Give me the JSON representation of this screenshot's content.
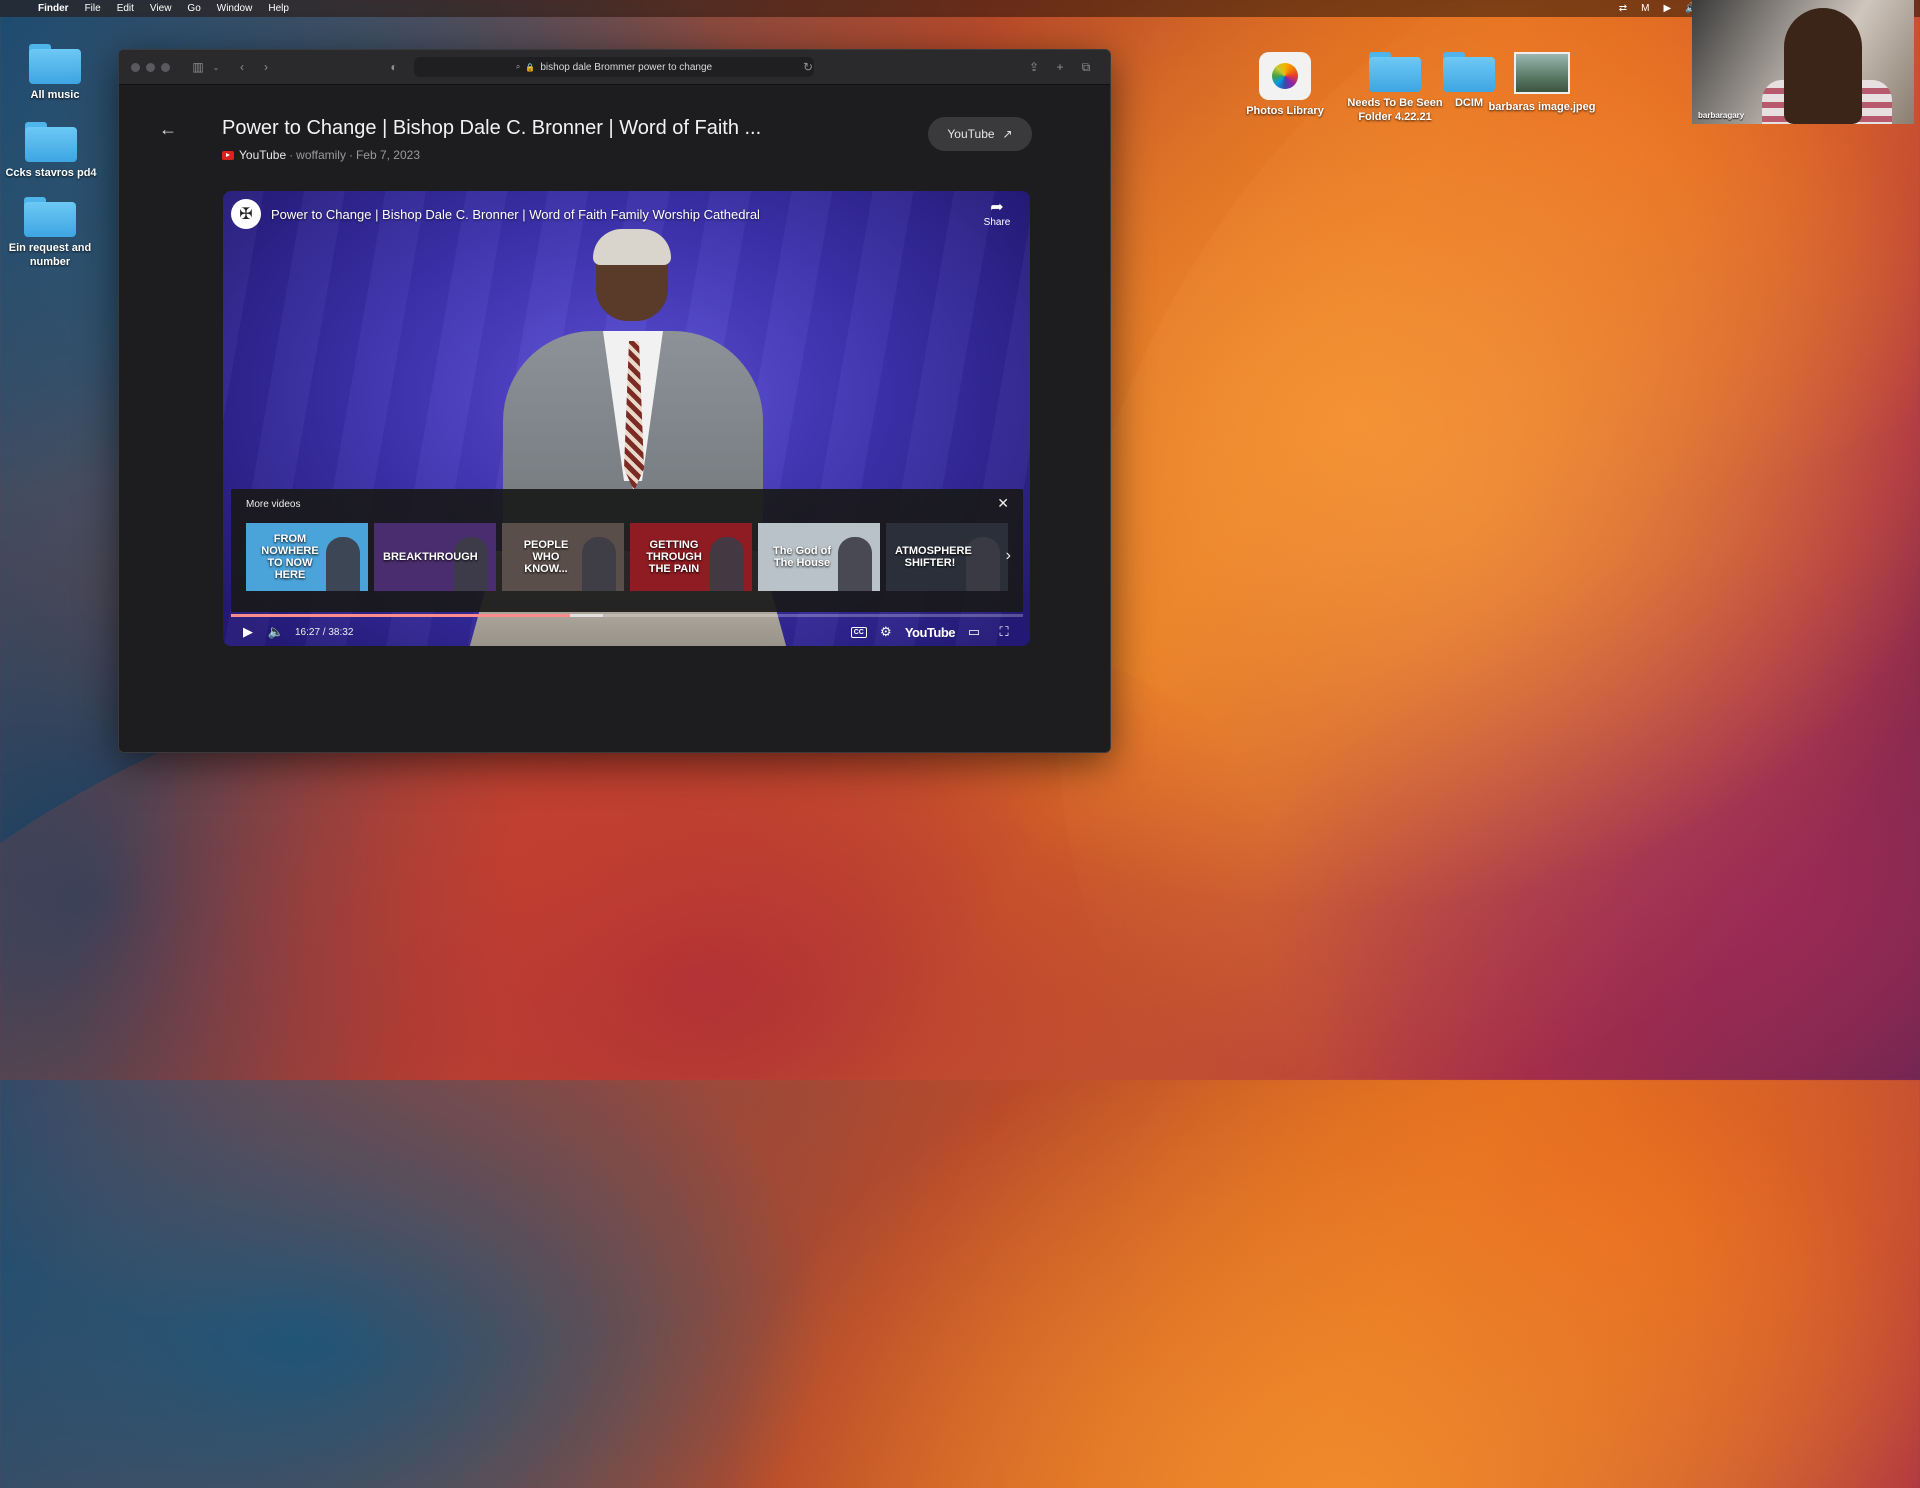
{
  "menubar": {
    "apple_glyph": "",
    "items": [
      "Finder",
      "File",
      "Edit",
      "View",
      "Go",
      "Window",
      "Help"
    ],
    "status_icons": [
      "screen-share-icon",
      "mail-icon",
      "play-icon",
      "volume-icon",
      "bluetooth-icon",
      "wifi-icon"
    ]
  },
  "desktop": {
    "left_items": [
      {
        "label": "All music",
        "icon": "folder-icon"
      },
      {
        "label": "Ccks stavros pd4",
        "icon": "folder-icon"
      },
      {
        "label": "Ein request and number",
        "icon": "folder-icon"
      }
    ],
    "top_items": [
      {
        "label": "Photos Library",
        "icon": "photos-icon"
      },
      {
        "label": "Needs To Be Seen Folder 4.22.21",
        "icon": "folder-icon"
      },
      {
        "label": "DCIM",
        "icon": "folder-icon"
      },
      {
        "label": "barbaras image.jpeg",
        "icon": "image-file-icon"
      }
    ]
  },
  "facetime": {
    "name": "barbaragary"
  },
  "browser": {
    "address": "bishop dale Brommer power to change",
    "page": {
      "title": "Power to Change | Bishop Dale C. Bronner | Word of Faith ...",
      "source": "YouTube",
      "channel": "woffamily",
      "date": "Feb 7, 2023",
      "separator": "·",
      "open_button": "YouTube"
    },
    "player": {
      "video_title": "Power to Change | Bishop Dale C. Bronner | Word of Faith Family Worship Cathedral",
      "share_label": "Share",
      "more_videos_label": "More videos",
      "thumbnails": [
        {
          "text": "FROM NOWHERE TO NOW HERE",
          "bg": "#4aa3d9"
        },
        {
          "text": "BREAKTHROUGH",
          "bg": "#4a2d6e"
        },
        {
          "text": "PEOPLE WHO KNOW...",
          "bg": "#5a4e4a"
        },
        {
          "text": "GETTING THROUGH THE PAIN",
          "bg": "#8e1c22"
        },
        {
          "text": "The God of The House",
          "bg": "#b9c2c8"
        },
        {
          "text": "ATMOSPHERE SHIFTER!",
          "bg": "#2a2f3a"
        }
      ],
      "time": "16:27 / 38:32",
      "progress_fraction": 0.428,
      "buffered_fraction": 0.47,
      "logo_word": "YouTube",
      "cc_label": "CC"
    }
  },
  "colors": {
    "accent_red": "#ff0000",
    "window_bg": "#1d1d1f",
    "folder_blue": "#4fb4ea"
  }
}
